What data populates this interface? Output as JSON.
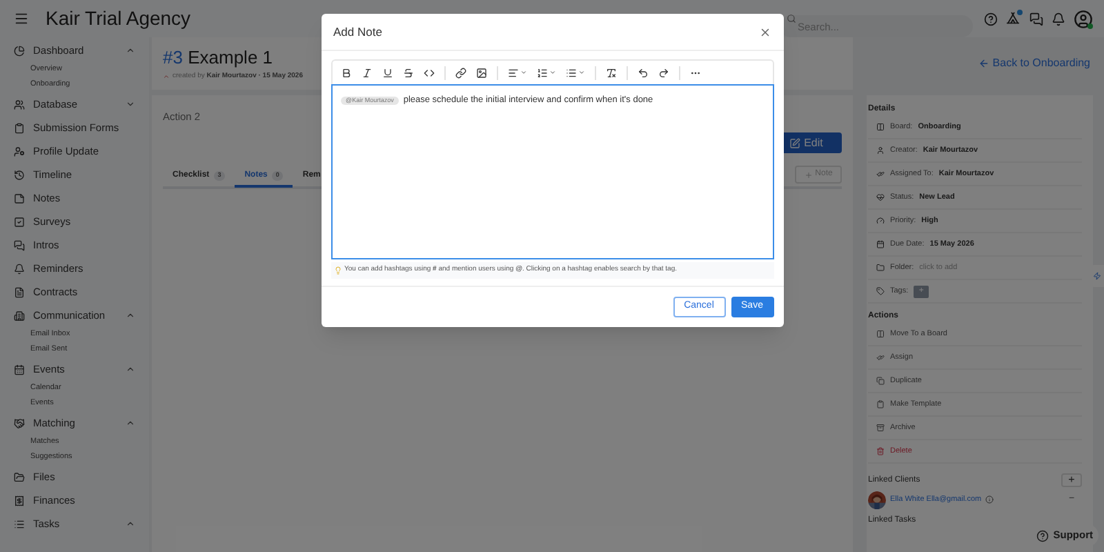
{
  "app": {
    "title": "Kair Trial Agency"
  },
  "search": {
    "placeholder": "Search..."
  },
  "user": {
    "online": true
  },
  "sidebar": {
    "items": [
      {
        "label": "Dashboard",
        "kind": "group",
        "expanded": true,
        "children": [
          {
            "label": "Overview"
          },
          {
            "label": "Onboarding"
          }
        ]
      },
      {
        "label": "Database",
        "kind": "group",
        "expanded": false
      },
      {
        "label": "Submission Forms",
        "kind": "link"
      },
      {
        "label": "Profile Update",
        "kind": "link"
      },
      {
        "label": "Timeline",
        "kind": "link"
      },
      {
        "label": "Notes",
        "kind": "link"
      },
      {
        "label": "Surveys",
        "kind": "link"
      },
      {
        "label": "Intros",
        "kind": "link"
      },
      {
        "label": "Reminders",
        "kind": "link"
      },
      {
        "label": "Contracts",
        "kind": "link"
      },
      {
        "label": "Communication",
        "kind": "group",
        "expanded": true,
        "children": [
          {
            "label": "Email Inbox"
          },
          {
            "label": "Email Sent"
          }
        ]
      },
      {
        "label": "Events",
        "kind": "group",
        "expanded": true,
        "children": [
          {
            "label": "Calendar"
          },
          {
            "label": "Events"
          }
        ]
      },
      {
        "label": "Matching",
        "kind": "group",
        "expanded": true,
        "children": [
          {
            "label": "Matches"
          },
          {
            "label": "Suggestions"
          }
        ]
      },
      {
        "label": "Files",
        "kind": "link"
      },
      {
        "label": "Finances",
        "kind": "link"
      },
      {
        "label": "Tasks",
        "kind": "group",
        "expanded": true
      }
    ]
  },
  "task": {
    "number": "#3",
    "title": "Example 1",
    "created_prefix": "created by",
    "creator": "Kair Mourtazov · 15 May 2026",
    "description": "Action 2",
    "edit": "Edit",
    "add_note": "Note"
  },
  "tabs": [
    {
      "label": "Checklist",
      "count": "3",
      "selected": false
    },
    {
      "label": "Notes",
      "count": "0",
      "selected": true
    },
    {
      "label": "Rem",
      "selected": false
    }
  ],
  "back_link": "Back to Onboarding",
  "details": {
    "title": "Details",
    "rows": [
      {
        "label": "Board:",
        "value": "Onboarding",
        "kind": "text"
      },
      {
        "label": "Creator:",
        "value": "Kair Mourtazov",
        "kind": "text"
      },
      {
        "label": "Assigned To:",
        "value": "Kair Mourtazov",
        "kind": "text"
      },
      {
        "label": "Status:",
        "value": "New Lead",
        "kind": "text"
      },
      {
        "label": "Priority:",
        "value": "High",
        "kind": "text"
      },
      {
        "label": "Due Date:",
        "value": "15 May 2026",
        "kind": "text"
      },
      {
        "label": "Folder:",
        "value": "click to add",
        "kind": "hint"
      },
      {
        "label": "Tags:",
        "value": "+",
        "kind": "button"
      }
    ]
  },
  "actions": {
    "title": "Actions",
    "items": [
      {
        "label": "Move To a Board",
        "kind": "normal"
      },
      {
        "label": "Assign",
        "kind": "normal"
      },
      {
        "label": "Duplicate",
        "kind": "normal"
      },
      {
        "label": "Make Template",
        "kind": "normal"
      },
      {
        "label": "Archive",
        "kind": "normal"
      },
      {
        "label": "Delete",
        "kind": "danger"
      }
    ]
  },
  "linked_clients": {
    "title": "Linked Clients",
    "add": "+",
    "clients": [
      {
        "name": "Ella White Ella@gmail.com",
        "remove": "−"
      }
    ]
  },
  "linked_tasks": {
    "title": "Linked Tasks"
  },
  "support": "Support",
  "dialog": {
    "title": "Add Note",
    "mention": "@Kair Mourtazov",
    "text": "please schedule the initial interview and confirm when it's done",
    "hint": "You can add hashtags using **#** and mention users using **@**. Clicking on a hashtag enables search by that tag.",
    "cancel": "Cancel",
    "save": "Save"
  }
}
